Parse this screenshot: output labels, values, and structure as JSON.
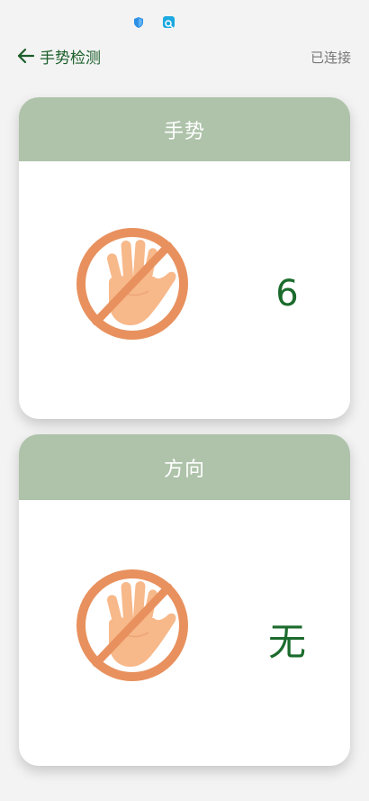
{
  "status_bar": {
    "icons": [
      "shield-icon",
      "search-app-icon"
    ]
  },
  "header": {
    "title": "手势检测",
    "back_icon": "arrow-left-icon",
    "connection_status": "已连接"
  },
  "colors": {
    "accent": "#1b5e2a",
    "card_header_bg": "#aec3aa",
    "value_color": "#1b6b2c",
    "icon_orange": "#e8915e"
  },
  "cards": [
    {
      "title": "手势",
      "icon": "no-hand-icon",
      "value": "6"
    },
    {
      "title": "方向",
      "icon": "no-hand-icon",
      "value": "无"
    }
  ]
}
